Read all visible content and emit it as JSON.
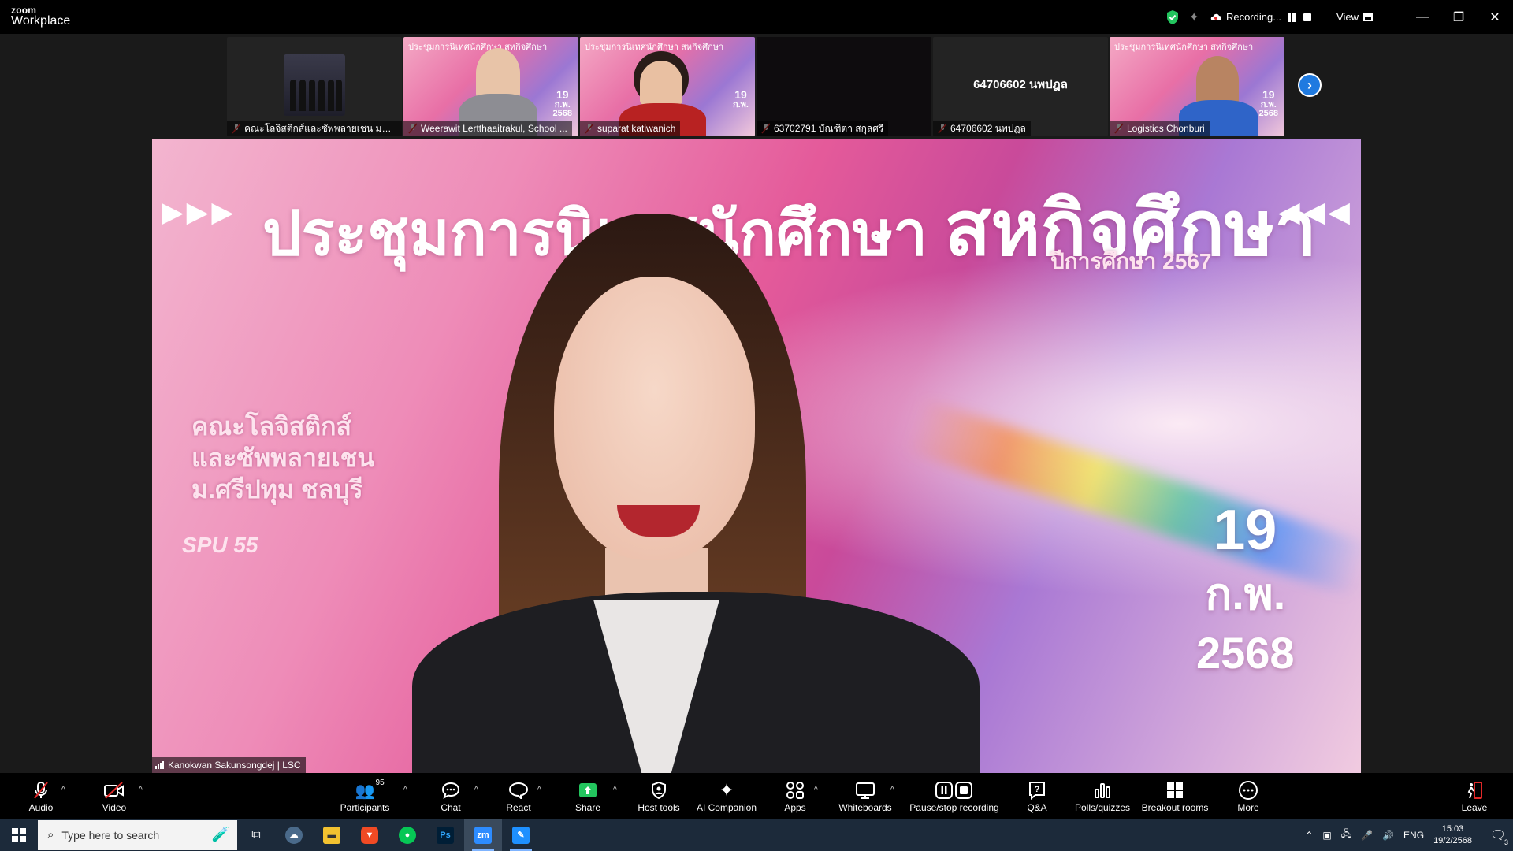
{
  "app": {
    "brand_top": "zoom",
    "brand_bottom": "Workplace"
  },
  "titlebar": {
    "recording_label": "Recording...",
    "view_label": "View"
  },
  "thumbnails": [
    {
      "name": "คณะโลจิสติกส์และซัพพลายเชน มหาวิ..."
    },
    {
      "name": "Weerawit Lertthaaitrakul, School ..."
    },
    {
      "name": "suparat katiwanich"
    },
    {
      "name": "63702791 บัณฑิตา สกุลศรี"
    },
    {
      "name": "64706602 นพปฎล",
      "big_name": "64706602 นพปฎล"
    },
    {
      "name": "Logistics Chonburi"
    }
  ],
  "thumb_banner": {
    "title": "ประชุมการนิเทศนักศึกษา สหกิจศึกษา",
    "date_day": "19",
    "date_month": "ก.พ.",
    "date_year": "2568"
  },
  "main_video": {
    "speaker_name": "Kanokwan Sakunsongdej | LSC",
    "banner_title": "ประชุมการนิเทศนักศึกษา",
    "banner_title_big": "สหกิจศึกษา",
    "banner_subtitle": "ปีการศึกษา 2567",
    "org_line1": "คณะโลจิสติกส์",
    "org_line2": "และซัพพลายเชน",
    "org_line3": "ม.ศรีปทุม ชลบุรี",
    "logos": "SPU 55",
    "date_day": "19",
    "date_month": "ก.พ.",
    "date_year": "2568"
  },
  "toolbar": {
    "audio": "Audio",
    "video": "Video",
    "participants": "Participants",
    "participants_count": "95",
    "chat": "Chat",
    "react": "React",
    "share": "Share",
    "host_tools": "Host tools",
    "ai_companion": "AI Companion",
    "apps": "Apps",
    "whiteboards": "Whiteboards",
    "pause_recording": "Pause/stop recording",
    "qa": "Q&A",
    "polls": "Polls/quizzes",
    "breakout": "Breakout rooms",
    "more": "More",
    "leave": "Leave"
  },
  "taskbar": {
    "search_placeholder": "Type here to search",
    "language": "ENG",
    "time": "15:03",
    "date": "19/2/2568",
    "notification_count": "3",
    "zoom_label": "zm",
    "ps_label": "Ps"
  },
  "colors": {
    "accent_blue": "#1f7ae0",
    "mute_red": "#e02828",
    "share_green": "#23c55e"
  }
}
